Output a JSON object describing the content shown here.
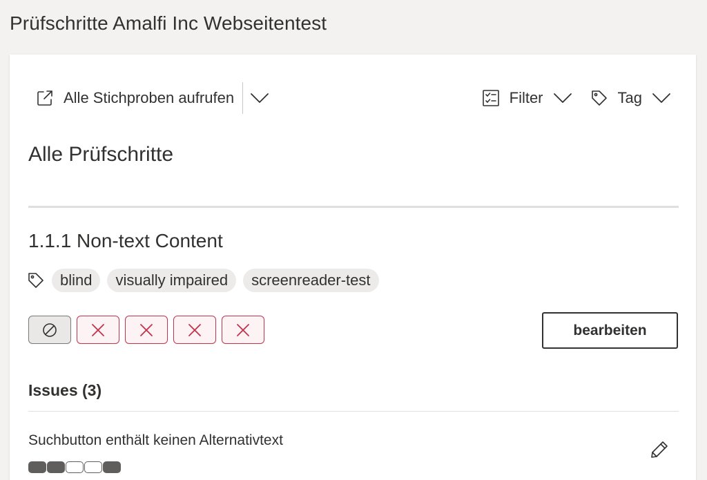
{
  "page": {
    "title": "Prüfschritte Amalfi Inc Webseitentest"
  },
  "toolbar": {
    "open_all_label": "Alle Stichproben aufrufen",
    "filter_label": "Filter",
    "tag_label": "Tag"
  },
  "section": {
    "heading": "Alle Prüfschritte"
  },
  "item": {
    "title": "1.1.1 Non-text Content",
    "tags": [
      "blind",
      "visually impaired",
      "screenreader-test"
    ],
    "statuses": [
      "not-applicable",
      "fail",
      "fail",
      "fail",
      "fail"
    ],
    "edit_label": "bearbeiten"
  },
  "issues": {
    "heading": "Issues (3)",
    "list": [
      {
        "title": "Suchbutton enthält keinen Alternativtext",
        "severity_segments": [
          true,
          true,
          false,
          false,
          true
        ]
      }
    ]
  },
  "colors": {
    "fail": "#c4314b",
    "na": "#605e5c",
    "text": "#323130"
  },
  "icons": {
    "open_all": "open-external-icon",
    "dropdown": "chevron-down-icon",
    "filter": "checklist-icon",
    "tag": "tag-icon",
    "na_status": "circle-slash-icon",
    "fail_status": "cross-icon",
    "edit_issue": "pencil-icon"
  }
}
